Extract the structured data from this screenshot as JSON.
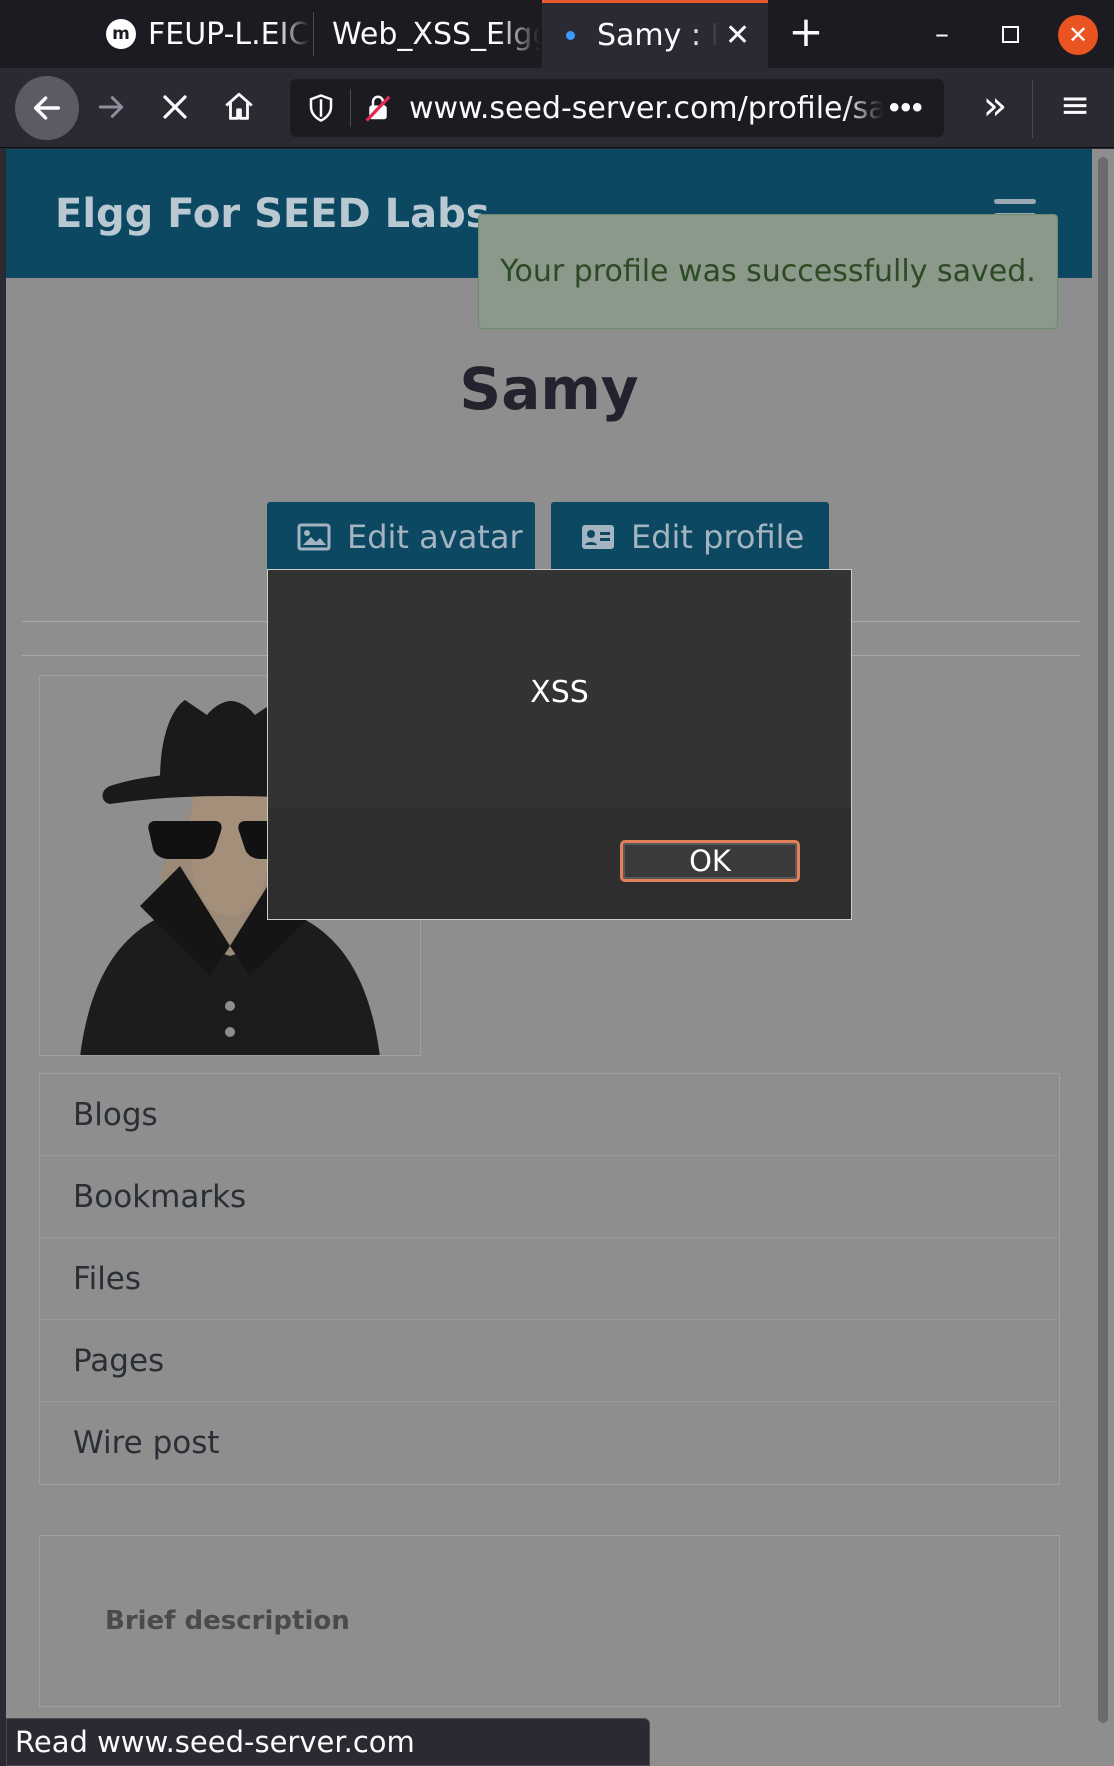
{
  "browser": {
    "tabs": [
      {
        "favicon": "m",
        "label": "FEUP-L.EIC"
      },
      {
        "label": "Web_XSS_Elgg"
      },
      {
        "label": "Samy : E",
        "loading": true
      }
    ],
    "new_tab": "+",
    "url": "www.seed-server.com/profile/samy",
    "url_more": "•••",
    "status_text": "Read www.seed-server.com",
    "icons": [
      "back-arrow-icon",
      "forward-arrow-icon",
      "stop-icon",
      "home-icon",
      "shield-icon",
      "insecure-lock-icon",
      "overflow-chevrons-icon",
      "hamburger-menu-icon"
    ]
  },
  "site": {
    "title": "Elgg For SEED Labs",
    "notice": "Your profile was successfully saved."
  },
  "profile": {
    "name": "Samy",
    "edit_avatar": "Edit avatar",
    "edit_profile": "Edit profile",
    "menu": [
      "Blogs",
      "Bookmarks",
      "Files",
      "Pages",
      "Wire post"
    ],
    "brief_description_label": "Brief description"
  },
  "alert": {
    "message": "XSS",
    "ok": "OK"
  },
  "colors": {
    "header": "#0c4862",
    "overlay_page": "#8e8e8e",
    "alert_bg": "#333333",
    "ok_focus": "#e2805a",
    "window_close": "#e95420"
  }
}
